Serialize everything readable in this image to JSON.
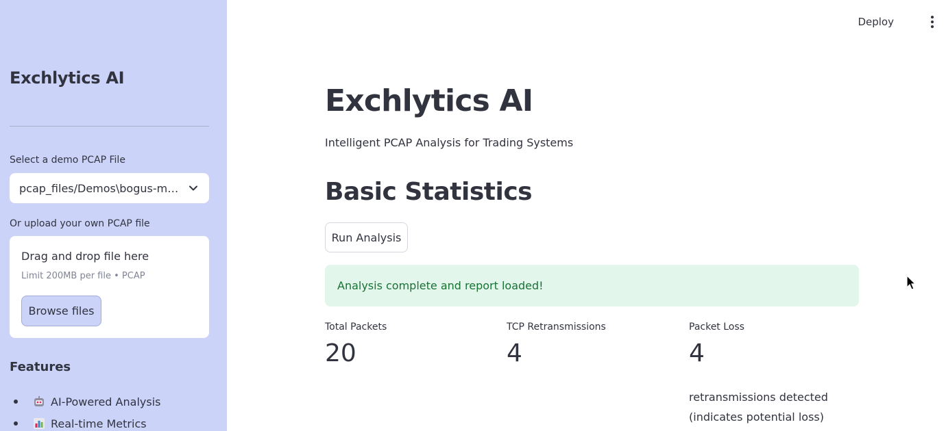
{
  "sidebar": {
    "title": "Exchlytics AI",
    "select_label": "Select a demo PCAP File",
    "select_value": "pcap_files/Demos\\bogus-m…",
    "upload_label": "Or upload your own PCAP file",
    "upload": {
      "title": "Drag and drop file here",
      "limit": "Limit 200MB per file • PCAP",
      "button": "Browse files"
    },
    "features_title": "Features",
    "features": [
      {
        "label": "AI-Powered Analysis",
        "icon": "robot-icon"
      },
      {
        "label": "Real-time Metrics",
        "icon": "bar-chart-icon"
      }
    ]
  },
  "header": {
    "deploy": "Deploy",
    "menu_icon": "kebab-menu-icon"
  },
  "main": {
    "title": "Exchlytics AI",
    "subtitle": "Intelligent PCAP Analysis for Trading Systems",
    "section_title": "Basic Statistics",
    "run_button": "Run Analysis",
    "alert": "Analysis complete and report loaded!",
    "metrics": [
      {
        "label": "Total Packets",
        "value": "20"
      },
      {
        "label": "TCP Retransmissions",
        "value": "4"
      },
      {
        "label": "Packet Loss",
        "value": "4"
      }
    ],
    "metric_note": "retransmissions detected (indicates potential loss)"
  },
  "colors": {
    "sidebar_bg": "#cbd3f9",
    "alert_bg": "#e3f6ec",
    "alert_text": "#177233",
    "text": "#31333f"
  }
}
